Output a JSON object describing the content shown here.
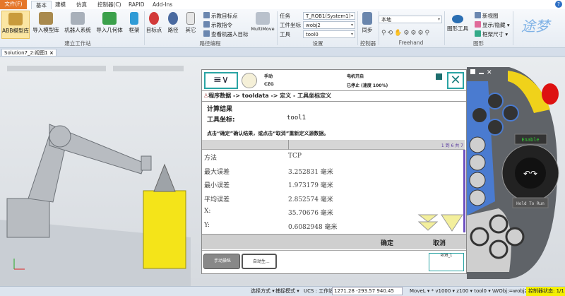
{
  "ribbon_tabs": [
    "文件(F)",
    "基本",
    "建模",
    "仿真",
    "控制器(C)",
    "RAPID",
    "Add-Ins"
  ],
  "ribbon": {
    "buttons": [
      "ABB模型库",
      "导入模型库",
      "机器人系统",
      "导入几何体",
      "框架",
      "目标点",
      "路径",
      "其它"
    ],
    "path_items": [
      "示教目标点",
      "示教指令",
      "查看机器人目标"
    ],
    "multimove": "MultiMove",
    "group_build": "建立工作站",
    "group_path": "路径编程",
    "settings_labels": [
      "任务",
      "工件坐标",
      "工具"
    ],
    "settings_values": [
      "T_ROB1(System1)",
      "wobj2",
      "tool0"
    ],
    "group_settings": "设置",
    "sync": "同步",
    "group_controller": "控制器",
    "freehand_combo": "本地",
    "group_freehand": "Freehand",
    "graphics_tools": "图形工具",
    "graphics_items": [
      "新视图",
      "显示/隐藏",
      "框架尺寸"
    ],
    "group_graphics": "图形"
  },
  "doc_tab": "Solution7_2:视图1",
  "pendant": {
    "mode": "手动",
    "system": "CZG",
    "motor": "电机开启",
    "state": "已停止 (速度 100%)",
    "breadcrumb": "程序数据 -> tooldata -> 定义 - 工具坐标定义",
    "heading": "计算结果",
    "tool_label": "工具坐标:",
    "tool_value": "tool1",
    "instruction": "点击“确定”确认结果，或点击“取消”重新定义源数据。",
    "paging": "1 到 6 共 7",
    "rows": [
      {
        "k": "方法",
        "v": "TCP"
      },
      {
        "k": "最大误差",
        "v": "3.252831 毫米"
      },
      {
        "k": "最小误差",
        "v": "1.973179 毫米"
      },
      {
        "k": "平均误差",
        "v": "2.852574 毫米"
      },
      {
        "k": "X:",
        "v": "35.70676 毫米"
      },
      {
        "k": "Y:",
        "v": "0.6082948 毫米"
      }
    ],
    "ok": "确定",
    "cancel": "取消",
    "task1": "手动操纵",
    "task2": "自动生...",
    "rob": "ROB_1",
    "enable": "Enable",
    "hold": "Hold To Run"
  },
  "status": {
    "select": "选择方式 ▾",
    "snap": "捕捉模式 ▾",
    "ucs": "UCS : 工作站",
    "coords": "1271.28   -293.57   940.45",
    "move": "MoveL ▾ * v1000 ▾ z100 ▾ tool0 ▾ \\WObj:=wobj2 ▾",
    "ctrl": "控制器状态:  1/1"
  }
}
